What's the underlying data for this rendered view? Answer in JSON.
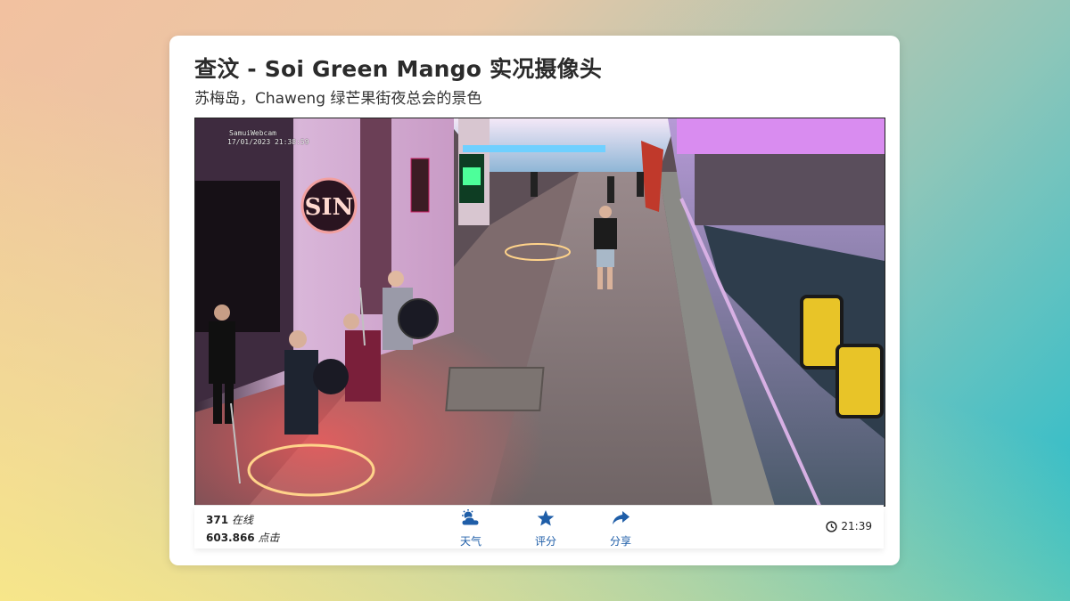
{
  "page": {
    "title": "查汶 - Soi Green Mango 实况摄像头",
    "subtitle": "苏梅岛，Chaweng 绿芒果街夜总会的景色"
  },
  "stream": {
    "overlay_brand": "SamuiWebcam",
    "overlay_timestamp": "17/01/2023 21:38:59",
    "sign_text": "SIN"
  },
  "stats": {
    "online_count": "371",
    "online_label": "在线",
    "views_count": "603.866",
    "views_label": "点击"
  },
  "actions": {
    "weather_label": "天气",
    "rate_label": "评分",
    "share_label": "分享"
  },
  "clock": {
    "time": "21:39"
  },
  "colors": {
    "accent": "#1f5ea8",
    "title": "#2b2b2b"
  },
  "icons": [
    "weather-icon",
    "star-icon",
    "share-icon",
    "clock-icon"
  ]
}
